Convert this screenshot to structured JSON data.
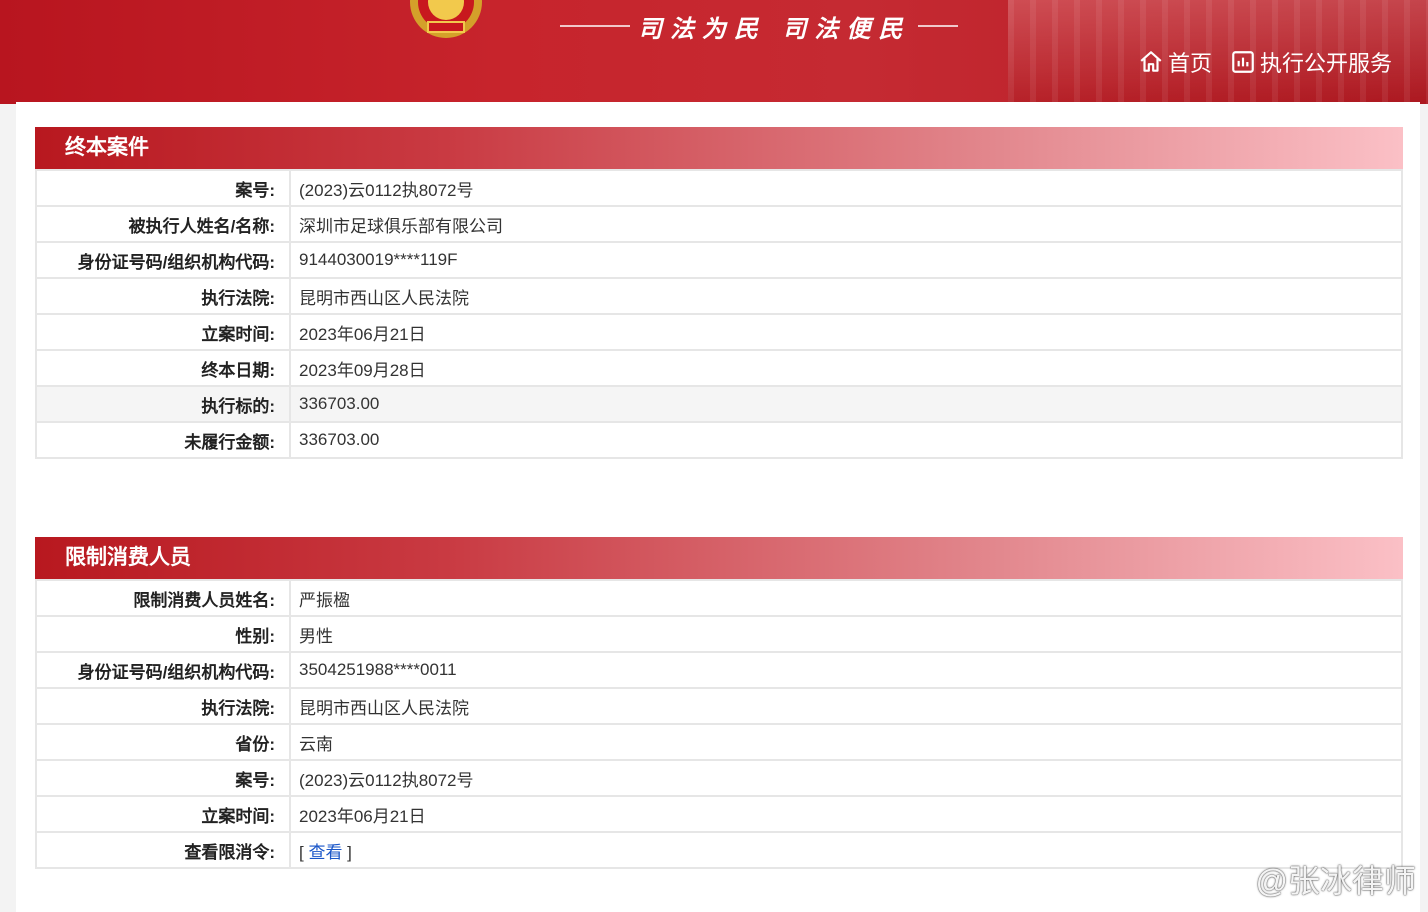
{
  "header": {
    "slogan": "司法为民  司法便民",
    "nav": {
      "home": "首页",
      "service": "执行公开服务"
    },
    "colors": {
      "brand_red": "#c0202a"
    }
  },
  "sections": [
    {
      "title": "终本案件",
      "rows": [
        {
          "label": "案号:",
          "value": "(2023)云0112执8072号"
        },
        {
          "label": "被执行人姓名/名称:",
          "value": "深圳市足球俱乐部有限公司"
        },
        {
          "label": "身份证号码/组织机构代码:",
          "value": "9144030019****119F"
        },
        {
          "label": "执行法院:",
          "value": "昆明市西山区人民法院"
        },
        {
          "label": "立案时间:",
          "value": "2023年06月21日"
        },
        {
          "label": "终本日期:",
          "value": "2023年09月28日"
        },
        {
          "label": "执行标的:",
          "value": "336703.00"
        },
        {
          "label": "未履行金额:",
          "value": "336703.00"
        }
      ]
    },
    {
      "title": "限制消费人员",
      "rows": [
        {
          "label": "限制消费人员姓名:",
          "value": "严振楹"
        },
        {
          "label": "性别:",
          "value": "男性"
        },
        {
          "label": "身份证号码/组织机构代码:",
          "value": "3504251988****0011"
        },
        {
          "label": "执行法院:",
          "value": "昆明市西山区人民法院"
        },
        {
          "label": "省份:",
          "value": "云南"
        },
        {
          "label": "案号:",
          "value": "(2023)云0112执8072号"
        },
        {
          "label": "立案时间:",
          "value": "2023年06月21日"
        },
        {
          "label": "查看限消令:",
          "value_prefix": "[ ",
          "link": "查看",
          "value_suffix": " ]"
        }
      ]
    }
  ],
  "watermark": "@张冰律师"
}
